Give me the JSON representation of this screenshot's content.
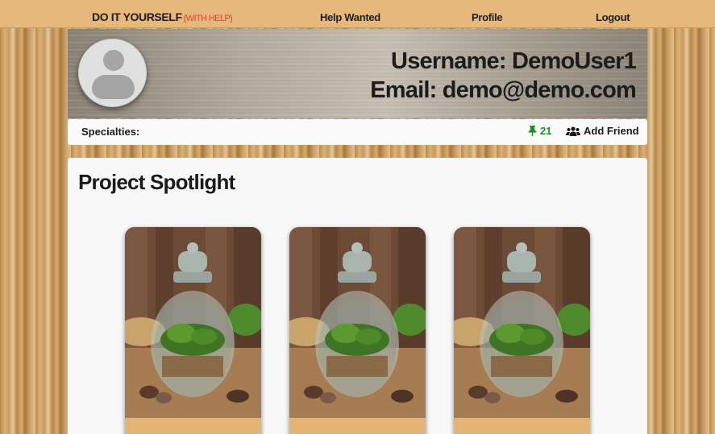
{
  "navbar": {
    "brand_main": "DO IT YOURSELF",
    "brand_help": "(WITH HELP)",
    "links": [
      "Help Wanted",
      "Profile",
      "Logout"
    ]
  },
  "profile": {
    "username_line": "Username: DemoUser1",
    "email_line": "Email: demo@demo.com",
    "avatar_icon": "user-silhouette-icon"
  },
  "infobar": {
    "specialties_label": "Specialties:",
    "pin_count": "21",
    "pin_icon": "thumbtack-icon",
    "add_friend_label": "Add Friend",
    "add_friend_icon": "users-icon"
  },
  "spotlight": {
    "title": "Project Spotlight",
    "cards": [
      {
        "image": "terrarium-jar-photo"
      },
      {
        "image": "terrarium-jar-photo"
      },
      {
        "image": "terrarium-jar-photo"
      }
    ]
  },
  "colors": {
    "navbar_bg": "#e6b87c",
    "brand_help": "#e23b3b",
    "pin_green": "#1e8e28",
    "card_footer": "#e3b474"
  }
}
